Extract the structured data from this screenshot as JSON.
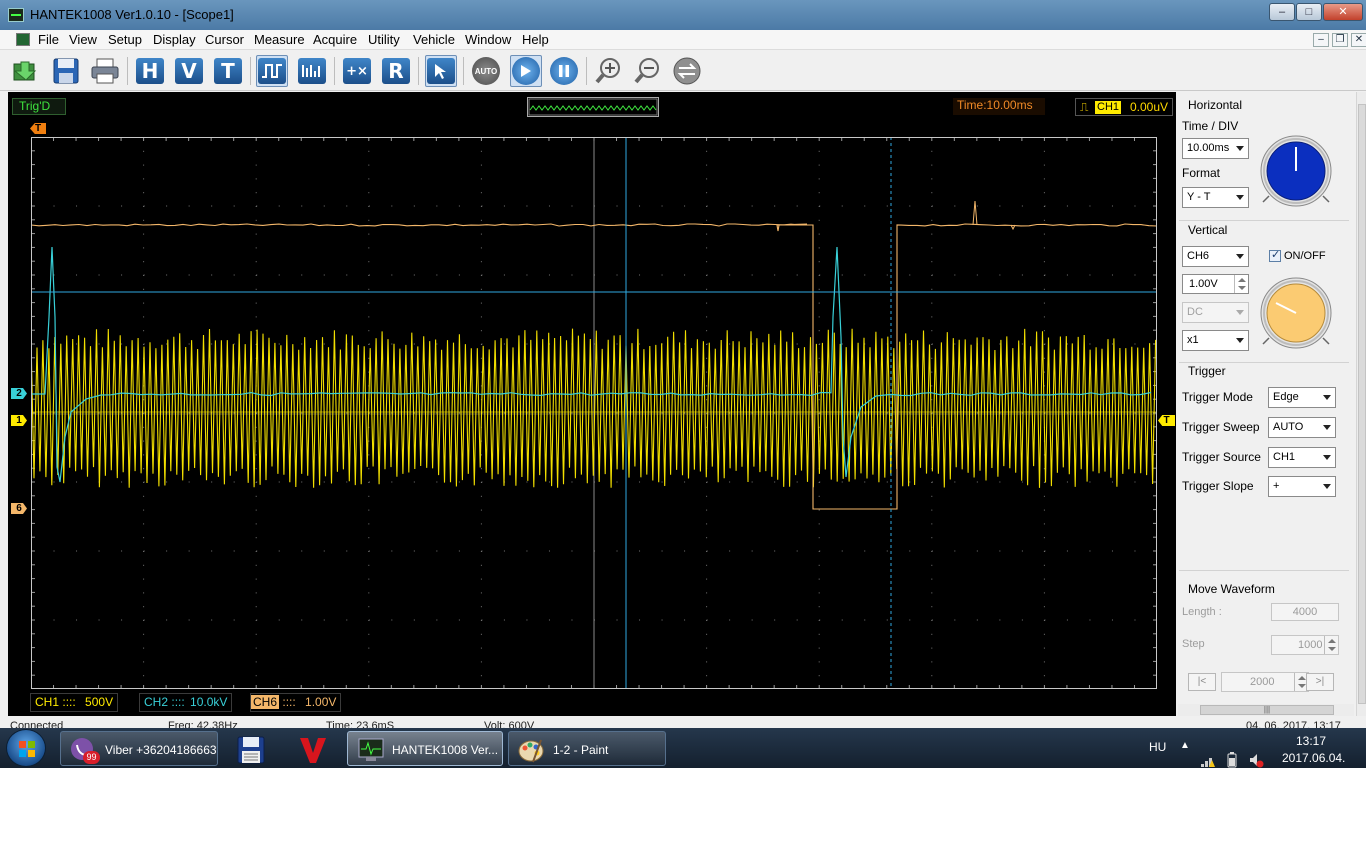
{
  "window": {
    "title": "HANTEK1008 Ver1.0.10 - [Scope1]",
    "controls": [
      "–",
      "□",
      "✕"
    ],
    "mdi_controls": [
      "–",
      "❐",
      "✕"
    ]
  },
  "menu": [
    "File",
    "View",
    "Setup",
    "Display",
    "Cursor",
    "Measure",
    "Acquire",
    "Utility",
    "Vehicle",
    "Window",
    "Help"
  ],
  "toolbar": {
    "h_label": "H",
    "v_label": "V",
    "t_label": "T",
    "r_label": "R",
    "auto_label": "AUTO"
  },
  "scope": {
    "trig_status": "Trig'D",
    "time_readout": "Time:10.00ms",
    "trigger_channel": "CH1",
    "trigger_level": "0.00uV",
    "marker_t": "T",
    "marker_2": "2",
    "marker_1": "1",
    "marker_6": "6",
    "marker_trigger_level": "T",
    "channel_labels": [
      {
        "name": "CH1",
        "coupling": "::::",
        "scale": "500V",
        "color": "#ffeb00"
      },
      {
        "name": "CH2",
        "coupling": "::::",
        "scale": "10.0kV",
        "color": "#39d0d8"
      },
      {
        "name": "CH6",
        "coupling": "::::",
        "scale": "1.00V",
        "color": "#f4b76a"
      }
    ]
  },
  "statusbar": {
    "connection": "Connected",
    "freq": "Freq: 42.38Hz",
    "time": "Time: 23.6mS",
    "volt": "Volt: 600V",
    "datetime": "04. 06. 2017. 13:17"
  },
  "panel": {
    "horizontal": {
      "title": "Horizontal",
      "time_div_label": "Time / DIV",
      "time_div_value": "10.00ms",
      "format_label": "Format",
      "format_value": "Y - T",
      "knob_color": "#0b2fbf"
    },
    "vertical": {
      "title": "Vertical",
      "channel_value": "CH6",
      "onoff_label": "ON/OFF",
      "volts_value": "1.00V",
      "coupling_value": "DC",
      "probe_value": "x1",
      "knob_color": "#fbcb72"
    },
    "trigger": {
      "title": "Trigger",
      "mode_label": "Trigger Mode",
      "mode_value": "Edge",
      "sweep_label": "Trigger Sweep",
      "sweep_value": "AUTO",
      "source_label": "Trigger Source",
      "source_value": "CH1",
      "slope_label": "Trigger Slope",
      "slope_value": "+"
    },
    "move_waveform": {
      "title": "Move Waveform",
      "length_label": "Length :",
      "length_value": "4000",
      "step_label": "Step",
      "step_value": "1000",
      "pos_value": "2000",
      "left_btn": "|<",
      "right_btn": ">|"
    }
  },
  "taskbar": {
    "items": [
      {
        "label": "Viber +36204186663",
        "badge": "99"
      },
      {
        "label": "HANTEK1008 Ver..."
      },
      {
        "label": "1-2 - Paint"
      }
    ],
    "lang": "HU",
    "clock_time": "13:17",
    "clock_date": "2017.06.04."
  }
}
